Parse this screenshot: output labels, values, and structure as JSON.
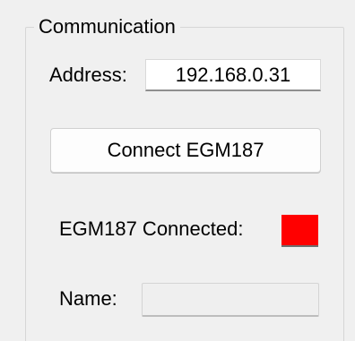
{
  "communication": {
    "group_title": "Communication",
    "address": {
      "label": "Address:",
      "value": "192.168.0.31"
    },
    "connect_button_label": "Connect EGM187",
    "status": {
      "label": "EGM187 Connected:",
      "indicator_color": "#ff0000"
    },
    "name": {
      "label": "Name:",
      "value": ""
    }
  }
}
